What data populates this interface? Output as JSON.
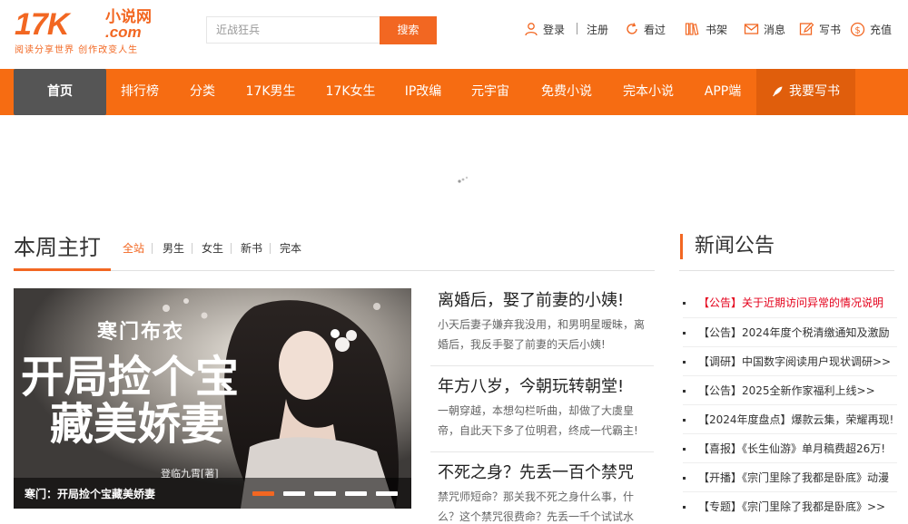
{
  "header": {
    "logo": {
      "main": "17K",
      "cn": "小说网",
      "com": ".com",
      "slogan": "阅读分享世界  创作改变人生"
    },
    "search": {
      "placeholder": "近战狂兵",
      "button": "搜索"
    },
    "user_links": {
      "login": "登录",
      "register": "注册",
      "history": "看过",
      "bookshelf": "书架",
      "messages": "消息",
      "write": "写书",
      "recharge": "充值"
    }
  },
  "nav": {
    "items": [
      "首页",
      "排行榜",
      "分类",
      "17K男生",
      "17K女生",
      "IP改编",
      "元宇宙",
      "免费小说",
      "完本小说",
      "APP端"
    ],
    "write": "我要写书"
  },
  "weekly": {
    "title": "本周主打",
    "tabs": [
      "全站",
      "男生",
      "女生",
      "新书",
      "完本"
    ],
    "banner": {
      "caption": "寒门：开局捡个宝藏美娇妻",
      "slide_count": 5,
      "active_slide": 1
    },
    "stories": [
      {
        "title": "离婚后，娶了前妻的小姨!",
        "desc": "小天后妻子嫌弃我没用，和男明星暧昧，离婚后，我反手娶了前妻的天后小姨!"
      },
      {
        "title": "年方八岁，今朝玩转朝堂!",
        "desc": "一朝穿越，本想勾栏听曲，却做了大虞皇帝，自此天下多了位明君，终成一代霸主!"
      },
      {
        "title": "不死之身？先丢一百个禁咒",
        "desc": "禁咒师短命？那关我不死之身什么事，什么？这个禁咒很费命？先丢一千个试试水"
      }
    ]
  },
  "news": {
    "title": "新闻公告",
    "items": [
      {
        "text": "【公告】关于近期访问异常的情况说明",
        "hot": true
      },
      {
        "text": "【公告】2024年度个税清缴通知及激励",
        "hot": false
      },
      {
        "text": "【调研】中国数字阅读用户现状调研>>",
        "hot": false
      },
      {
        "text": "【公告】2025全新作家福利上线>>",
        "hot": false
      },
      {
        "text": "【2024年度盘点】爆款云集，荣耀再现!",
        "hot": false
      },
      {
        "text": "【喜报】《长生仙游》单月稿费超26万!",
        "hot": false
      },
      {
        "text": "【开播】《宗门里除了我都是卧底》动漫",
        "hot": false
      },
      {
        "text": "【专题】《宗门里除了我都是卧底》>>",
        "hot": false
      }
    ]
  },
  "colors": {
    "brand": "#f26722",
    "nav_bg": "#f66c12",
    "nav_active": "#555555",
    "hot_news": "#e4001b"
  },
  "icons": {
    "login": "user-icon",
    "history": "refresh-icon",
    "bookshelf": "bookshelf-icon",
    "messages": "envelope-icon",
    "write": "pencil-icon",
    "recharge": "coin-icon",
    "nav_write": "quill-icon"
  }
}
